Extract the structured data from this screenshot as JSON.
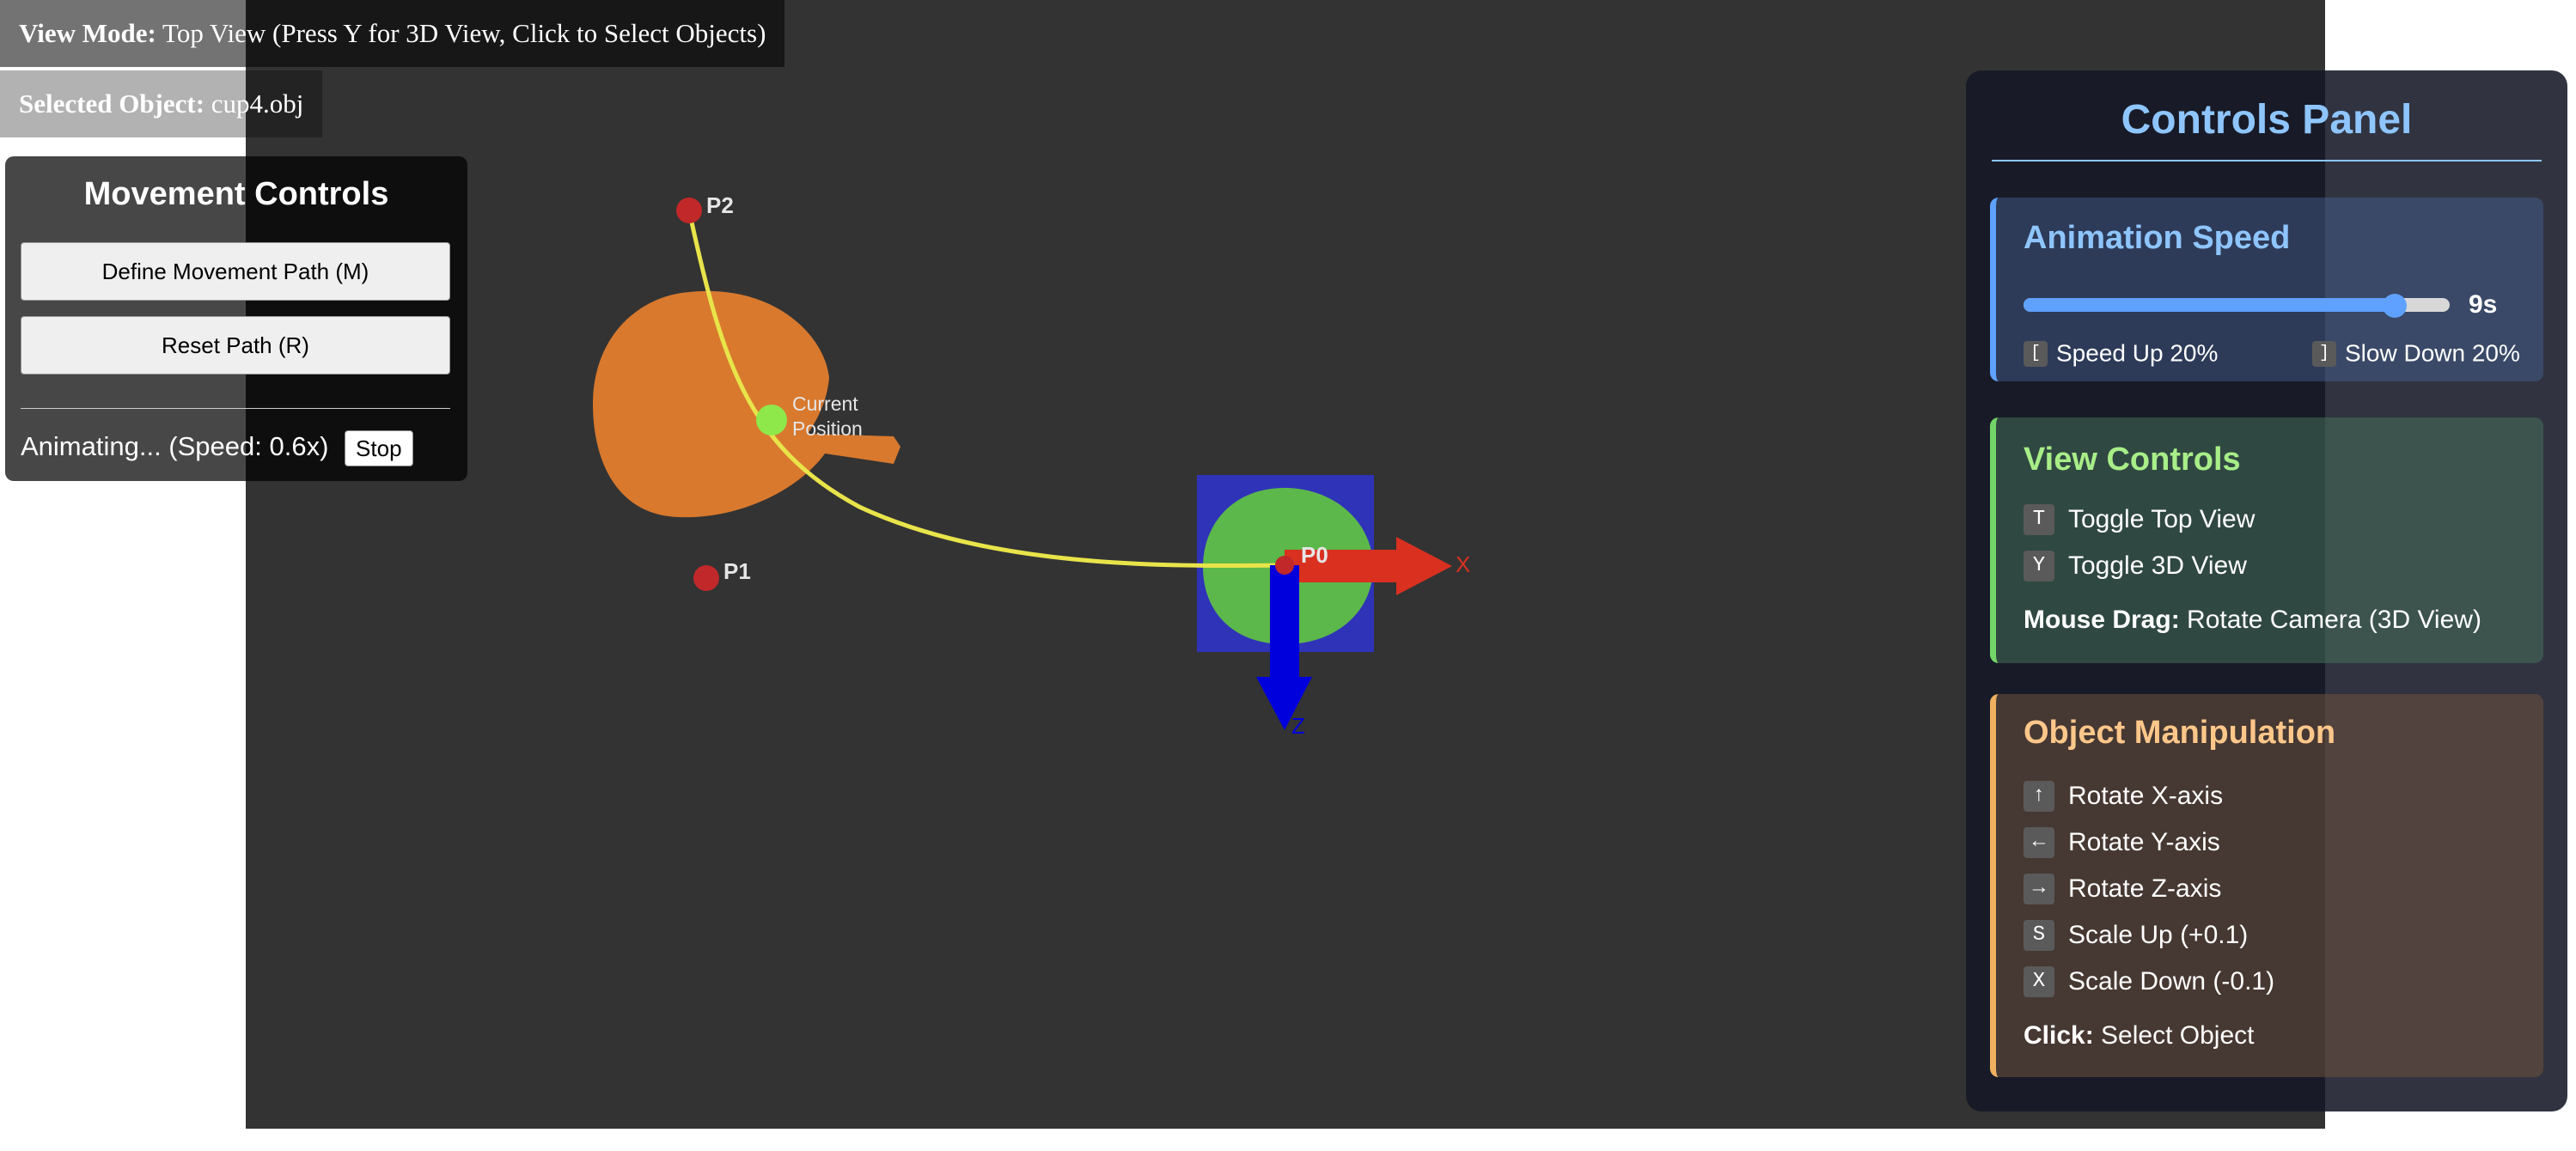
{
  "status": {
    "view_mode_label": "View Mode:",
    "view_mode_value": "Top View (Press Y for 3D View, Click to Select Objects)",
    "selected_label": "Selected Object:",
    "selected_value": "cup4.obj"
  },
  "movement": {
    "title": "Movement Controls",
    "define_path_label": "Define Movement Path (M)",
    "reset_path_label": "Reset Path (R)",
    "animating_text": "Animating... (Speed: 0.6x)",
    "stop_label": "Stop"
  },
  "scene": {
    "p0_label": "P0",
    "p1_label": "P1",
    "p2_label": "P2",
    "current_line1": "Current",
    "current_line2": "Position",
    "x_axis_label": "X",
    "z_axis_label": "Z"
  },
  "controls": {
    "title": "Controls Panel",
    "speed": {
      "heading": "Animation Speed",
      "value_label": "9s",
      "slider_fraction": 0.87,
      "speed_up_key": "[",
      "speed_up_label": "Speed Up 20%",
      "slow_down_key": "]",
      "slow_down_label": "Slow Down 20%"
    },
    "view": {
      "heading": "View Controls",
      "top_key": "T",
      "top_label": "Toggle Top View",
      "three_d_key": "Y",
      "three_d_label": "Toggle 3D View",
      "drag_bold": "Mouse Drag:",
      "drag_text": "Rotate Camera (3D View)"
    },
    "object": {
      "heading": "Object Manipulation",
      "items": [
        {
          "key": "↑",
          "label": "Rotate X-axis"
        },
        {
          "key": "←",
          "label": "Rotate Y-axis"
        },
        {
          "key": "→",
          "label": "Rotate Z-axis"
        },
        {
          "key": "S",
          "label": "Scale Up (+0.1)"
        },
        {
          "key": "X",
          "label": "Scale Down (-0.1)"
        }
      ],
      "click_bold": "Click:",
      "click_text": "Select Object"
    }
  },
  "colors": {
    "background": "#333333",
    "orange_object": "#d8792e",
    "green_object": "#5cb84a",
    "selection_box": "#2f33b8",
    "path": "#e8e44a",
    "control_point": "#c0282a",
    "current_marker": "#8ee84a",
    "x_axis": "#d93020",
    "z_axis": "#0000dd",
    "panel_accent": "#8ec5ff"
  }
}
